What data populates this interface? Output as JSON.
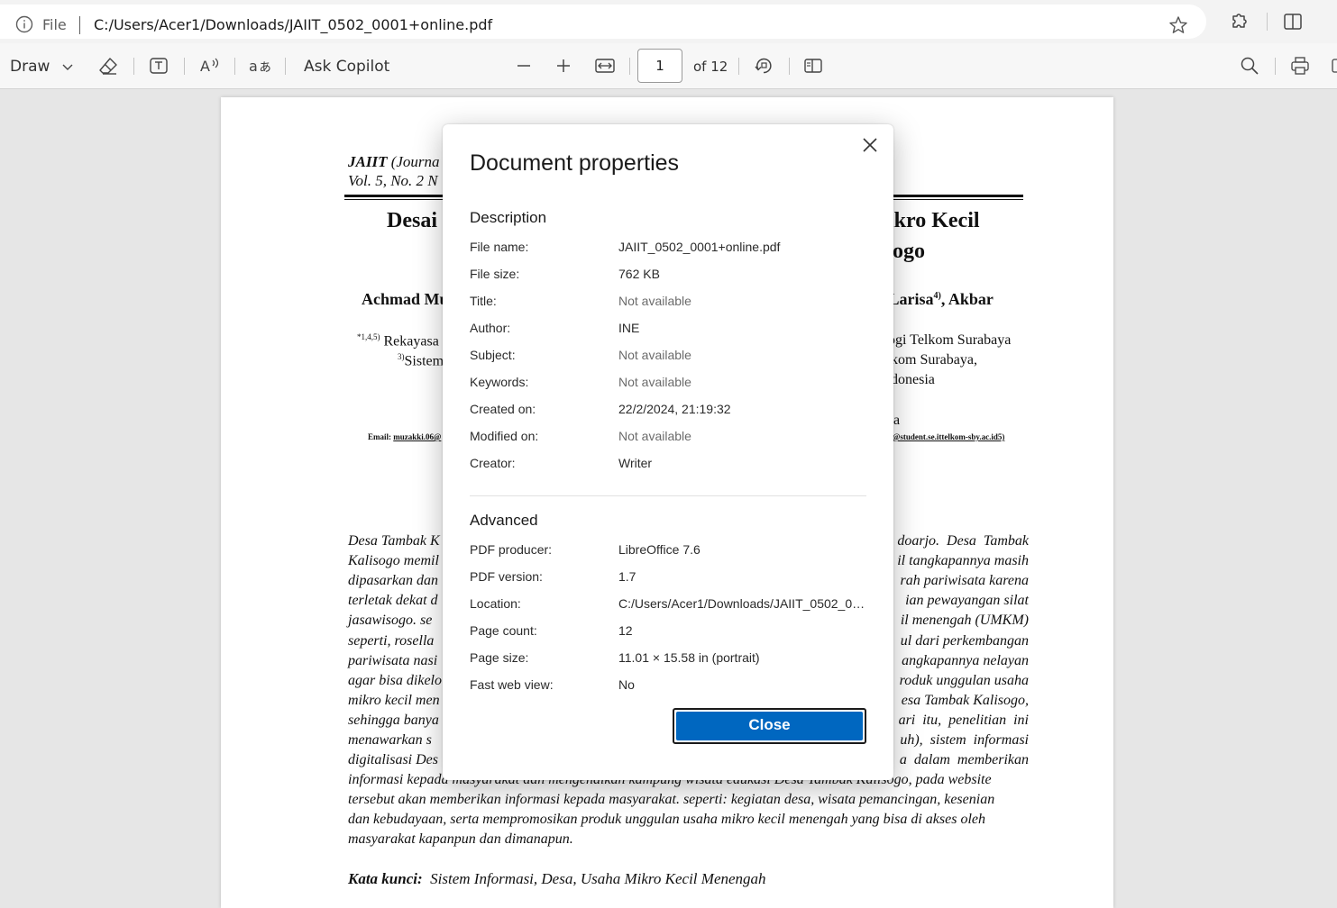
{
  "address_bar": {
    "scheme_label": "File",
    "url": "C:/Users/Acer1/Downloads/JAIIT_0502_0001+online.pdf"
  },
  "toolbar": {
    "draw_label": "Draw",
    "copilot_label": "Ask Copilot",
    "page_number": "1",
    "page_total": "of 12"
  },
  "pdf": {
    "journal_line1_bold": "JAIIT",
    "journal_line1_rest": " (Journa",
    "journal_line2": "Vol. 5, No. 2 N",
    "title_left": "Desai",
    "title_right1": "ikro Kecil",
    "title_right2": "ogo",
    "authors_left": "Achmad Mu",
    "authors_right_a": "e Larisa",
    "authors_right_sup": "4)",
    "authors_right_b": ", Akbar",
    "affil_left1_sup": "*1,4,5)",
    "affil_left1": " Rekayasa",
    "affil_left2_sup": "3)",
    "affil_left2": "Sistem",
    "affil_right1": "ogi Telkom Surabaya",
    "affil_right2": "kom Surabaya,",
    "affil_right3": "donesia",
    "affil_right4": "a",
    "email_left_label": "Email: ",
    "email_left_link": "muzakki.06@",
    "email_right": "@student.se.ittelkom-sby.ac.id5)",
    "abstract_left": [
      "Desa Tambak K",
      "Kalisogo memil",
      "dipasarkan dan",
      "terletak dekat d",
      "jasawisogo.  se",
      "seperti, rosella",
      "pariwisata nasi",
      "agar bisa dikelo",
      "mikro kecil men",
      "sehingga  banya",
      "menawarkan  s",
      "digitalisasi  Des"
    ],
    "abstract_right": [
      "doarjo.  Desa  Tambak",
      "il tangkapannya masih",
      "rah pariwisata karena",
      "ian pewayangan silat",
      "il menengah (UMKM)",
      "ul dari perkembangan",
      "angkapannya nelayan",
      "roduk unggulan usaha",
      "esa Tambak Kalisogo,",
      "ari  itu,  penelitian  ini",
      "uh),  sistem  informasi",
      "a  dalam  memberikan"
    ],
    "abstract_full": [
      "informasi kepada masyarakat dan mengenalkan kampung wisata edukasi Desa Tambak Kalisogo, pada website",
      "tersebut akan memberikan informasi kepada masyarakat. seperti: kegiatan desa, wisata pemancingan, kesenian",
      "dan kebudayaan, serta mempromosikan produk unggulan usaha mikro kecil menengah yang bisa di akses oleh",
      "masyarakat kapanpun dan dimanapun."
    ],
    "keywords_label": "Kata kunci:",
    "keywords_text": "Sistem Informasi, Desa, Usaha Mikro Kecil Menengah"
  },
  "dialog": {
    "title": "Document properties",
    "description_heading": "Description",
    "description": [
      {
        "label": "File name:",
        "value": "JAIIT_0502_0001+online.pdf"
      },
      {
        "label": "File size:",
        "value": "762 KB"
      },
      {
        "label": "Title:",
        "value": "Not available"
      },
      {
        "label": "Author:",
        "value": "INE"
      },
      {
        "label": "Subject:",
        "value": "Not available"
      },
      {
        "label": "Keywords:",
        "value": "Not available"
      },
      {
        "label": "Created on:",
        "value": "22/2/2024, 21:19:32"
      },
      {
        "label": "Modified on:",
        "value": "Not available"
      },
      {
        "label": "Creator:",
        "value": "Writer"
      }
    ],
    "advanced_heading": "Advanced",
    "advanced": [
      {
        "label": "PDF producer:",
        "value": "LibreOffice 7.6"
      },
      {
        "label": "PDF version:",
        "value": "1.7"
      },
      {
        "label": "Location:",
        "value": "C:/Users/Acer1/Downloads/JAIIT_0502_0001+online.pdf"
      },
      {
        "label": "Page count:",
        "value": "12"
      },
      {
        "label": "Page size:",
        "value": "11.01 × 15.58 in (portrait)"
      },
      {
        "label": "Fast web view:",
        "value": "No"
      }
    ],
    "close_label": "Close"
  },
  "icons": {
    "info": "info-icon",
    "favorite": "star-icon",
    "extensions": "puzzle-icon",
    "split": "split-screen-icon",
    "draw_chevron": "chevron-down-icon",
    "eraser": "eraser-icon",
    "text_box": "text-box-icon",
    "read_aloud": "read-aloud-icon",
    "translate": "translate-icon",
    "zoom_out": "minus-icon",
    "zoom_in": "plus-icon",
    "fit": "fit-width-icon",
    "rotate": "rotate-icon",
    "page_view": "page-view-icon",
    "search": "search-icon",
    "print": "print-icon",
    "close": "close-icon"
  },
  "colors": {
    "accent": "#0067c0",
    "not_available": "#6b6b6b"
  }
}
